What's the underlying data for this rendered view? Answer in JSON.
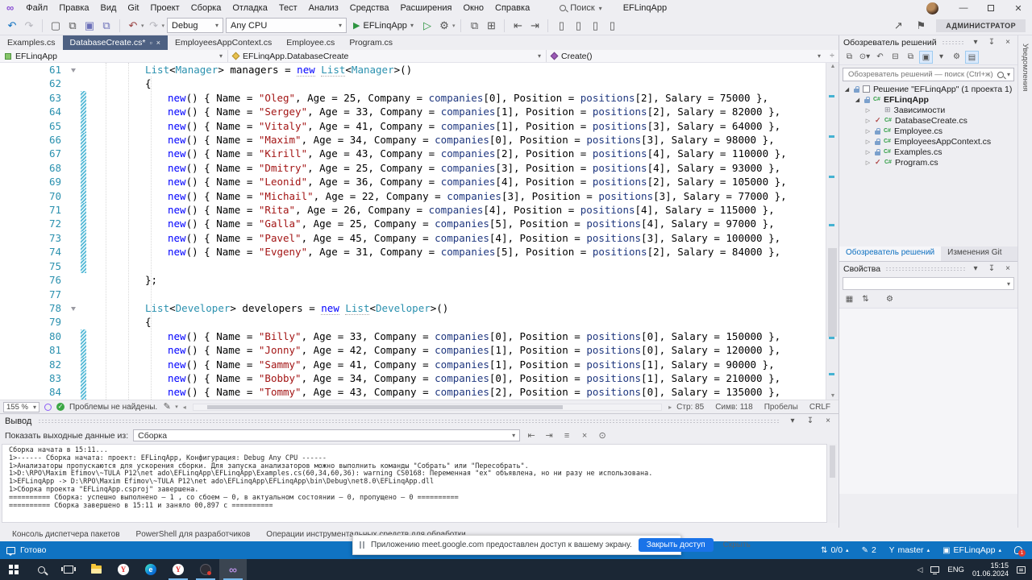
{
  "titlebar": {
    "menu": [
      "Файл",
      "Правка",
      "Вид",
      "Git",
      "Проект",
      "Сборка",
      "Отладка",
      "Тест",
      "Анализ",
      "Средства",
      "Расширения",
      "Окно",
      "Справка"
    ],
    "search_label": "Поиск",
    "window_title": "EFLinqApp"
  },
  "toolbar": {
    "config": "Debug",
    "platform": "Any CPU",
    "run_label": "EFLinqApp",
    "admin_badge": "АДМИНИСТРАТОР"
  },
  "tabs": [
    {
      "label": "Examples.cs",
      "active": false
    },
    {
      "label": "DatabaseCreate.cs*",
      "active": true
    },
    {
      "label": "EmployeesAppContext.cs",
      "active": false
    },
    {
      "label": "Employee.cs",
      "active": false
    },
    {
      "label": "Program.cs",
      "active": false
    }
  ],
  "breadcrumb": {
    "segments": [
      "EFLinqApp",
      "EFLinqApp.DatabaseCreate",
      "Create()"
    ]
  },
  "editor": {
    "zoom_level": "155 %",
    "problems_text": "Проблемы не найдены.",
    "caret": {
      "line": "Стр: 85",
      "column": "Симв: 118",
      "spaces": "Пробелы",
      "eol": "CRLF"
    },
    "lines": [
      {
        "n": 61,
        "kind": "decl",
        "type": "Manager",
        "varname": "managers",
        "ind": 2,
        "fold": true
      },
      {
        "n": 62,
        "kind": "brace",
        "text": "{",
        "ind": 2
      },
      {
        "n": 63,
        "kind": "item",
        "name": "Oleg",
        "age": 25,
        "comp": 0,
        "pos": 2,
        "salary": 75000,
        "ind": 3,
        "chg": true
      },
      {
        "n": 64,
        "kind": "item",
        "name": "Sergey",
        "age": 33,
        "comp": 1,
        "pos": 2,
        "salary": 82000,
        "ind": 3,
        "chg": true
      },
      {
        "n": 65,
        "kind": "item",
        "name": "Vitaly",
        "age": 41,
        "comp": 1,
        "pos": 3,
        "salary": 64000,
        "ind": 3,
        "chg": true
      },
      {
        "n": 66,
        "kind": "item",
        "name": "Maxim",
        "age": 34,
        "comp": 0,
        "pos": 3,
        "salary": 98000,
        "ind": 3,
        "chg": true
      },
      {
        "n": 67,
        "kind": "item",
        "name": "Kirill",
        "age": 43,
        "comp": 2,
        "pos": 4,
        "salary": 110000,
        "ind": 3,
        "chg": true
      },
      {
        "n": 68,
        "kind": "item",
        "name": "Dmitry",
        "age": 25,
        "comp": 3,
        "pos": 4,
        "salary": 93000,
        "ind": 3,
        "chg": true
      },
      {
        "n": 69,
        "kind": "item",
        "name": "Leonid",
        "age": 36,
        "comp": 4,
        "pos": 2,
        "salary": 105000,
        "ind": 3,
        "chg": true
      },
      {
        "n": 70,
        "kind": "item",
        "name": "Michail",
        "age": 22,
        "comp": 3,
        "pos": 3,
        "salary": 77000,
        "ind": 3,
        "chg": true
      },
      {
        "n": 71,
        "kind": "item",
        "name": "Rita",
        "age": 26,
        "comp": 4,
        "pos": 4,
        "salary": 115000,
        "ind": 3,
        "chg": true
      },
      {
        "n": 72,
        "kind": "item",
        "name": "Galla",
        "age": 25,
        "comp": 5,
        "pos": 4,
        "salary": 97000,
        "ind": 3,
        "chg": true
      },
      {
        "n": 73,
        "kind": "item",
        "name": "Pavel",
        "age": 45,
        "comp": 4,
        "pos": 3,
        "salary": 100000,
        "ind": 3,
        "chg": true
      },
      {
        "n": 74,
        "kind": "item",
        "name": "Evgeny",
        "age": 31,
        "comp": 5,
        "pos": 2,
        "salary": 84000,
        "ind": 3,
        "chg": true
      },
      {
        "n": 75,
        "kind": "empty",
        "chg": true
      },
      {
        "n": 76,
        "kind": "brace",
        "text": "};",
        "ind": 2
      },
      {
        "n": 77,
        "kind": "empty"
      },
      {
        "n": 78,
        "kind": "decl",
        "type": "Developer",
        "varname": "developers",
        "ind": 2,
        "fold": true
      },
      {
        "n": 79,
        "kind": "brace",
        "text": "{",
        "ind": 2
      },
      {
        "n": 80,
        "kind": "item",
        "name": "Billy",
        "age": 33,
        "comp": 0,
        "pos": 0,
        "salary": 150000,
        "ind": 3,
        "chg": true
      },
      {
        "n": 81,
        "kind": "item",
        "name": "Jonny",
        "age": 42,
        "comp": 1,
        "pos": 0,
        "salary": 120000,
        "ind": 3,
        "chg": true
      },
      {
        "n": 82,
        "kind": "item",
        "name": "Sammy",
        "age": 41,
        "comp": 1,
        "pos": 1,
        "salary": 90000,
        "ind": 3,
        "chg": true
      },
      {
        "n": 83,
        "kind": "item",
        "name": "Bobby",
        "age": 34,
        "comp": 0,
        "pos": 1,
        "salary": 210000,
        "ind": 3,
        "chg": true
      },
      {
        "n": 84,
        "kind": "item",
        "name": "Tommy",
        "age": 43,
        "comp": 2,
        "pos": 0,
        "salary": 135000,
        "ind": 3,
        "chg": true
      }
    ]
  },
  "solution_explorer": {
    "title": "Обозреватель решений",
    "search_placeholder": "Обозреватель решений — поиск (Ctrl+ж)",
    "tree": [
      {
        "label": "Решение \"EFLinqApp\" (1 проекта 1)",
        "level": 0,
        "arrow": "open",
        "icon": "solution",
        "status": "lock"
      },
      {
        "label": "EFLinqApp",
        "level": 1,
        "arrow": "open",
        "icon": "csproj",
        "status": "lock",
        "bold": true
      },
      {
        "label": "Зависимости",
        "level": 2,
        "arrow": "closed",
        "icon": "dep",
        "status": "none"
      },
      {
        "label": "DatabaseCreate.cs",
        "level": 2,
        "arrow": "closed",
        "icon": "cs",
        "status": "check"
      },
      {
        "label": "Employee.cs",
        "level": 2,
        "arrow": "closed",
        "icon": "cs",
        "status": "lock"
      },
      {
        "label": "EmployeesAppContext.cs",
        "level": 2,
        "arrow": "closed",
        "icon": "cs",
        "status": "lock"
      },
      {
        "label": "Examples.cs",
        "level": 2,
        "arrow": "closed",
        "icon": "cs",
        "status": "lock"
      },
      {
        "label": "Program.cs",
        "level": 2,
        "arrow": "closed",
        "icon": "cs",
        "status": "check"
      }
    ],
    "bottom_tabs": [
      {
        "label": "Обозреватель решений",
        "active": true
      },
      {
        "label": "Изменения Git",
        "active": false
      }
    ]
  },
  "properties_panel": {
    "title": "Свойства"
  },
  "right_strip": {
    "label": "Уведомления"
  },
  "output": {
    "title": "Вывод",
    "filter_label": "Показать выходные данные из:",
    "source_value": "Сборка",
    "lines": [
      "Сборка начата в 15:11...",
      "1>------ Сборка начата: проект: EFLinqApp, Конфигурация: Debug Any CPU ------",
      "1>Анализаторы пропускаются для ускорения сборки. Для запуска анализаторов можно выполнить команды \"Собрать\" или \"Пересобрать\".",
      "1>D:\\RPO\\Maxim Efimov\\~TULA P12\\net ado\\EFLinqApp\\EFLinqApp\\Examples.cs(60,34,60,36): warning CS0168: Переменная \"ex\" объявлена, но ни разу не использована.",
      "1>EFLinqApp -> D:\\RPO\\Maxim Efimov\\~TULA P12\\net ado\\EFLinqApp\\EFLinqApp\\bin\\Debug\\net8.0\\EFLinqApp.dll",
      "1>Сборка проекта \"EFLinqApp.csproj\" завершена.",
      "========== Сборка: успешно выполнено — 1 , со сбоем — 0, в актуальном состоянии — 0, пропущено — 0 ==========",
      "========== Сборка завершено в 15:11 и заняло 00,897 с =========="
    ]
  },
  "panel_tabs": [
    "Консоль диспетчера пакетов",
    "PowerShell для разработчиков",
    "Операции инструментальных средств для обработки..."
  ],
  "status_bar": {
    "ready": "Готово",
    "sync_count": "0/0",
    "pending_changes": "2",
    "branch": "master",
    "repo": "EFLinqApp",
    "bell_badge": "1"
  },
  "notification": {
    "message": "Приложению meet.google.com предоставлен доступ к вашему экрану.",
    "stop_button": "Закрыть доступ",
    "hide_button": "Скрыть"
  },
  "taskbar": {
    "buttons": [
      {
        "name": "start"
      },
      {
        "name": "search"
      },
      {
        "name": "task-view"
      },
      {
        "name": "file-explorer"
      },
      {
        "name": "yandex-browser"
      },
      {
        "name": "edge"
      },
      {
        "name": "yandex-browser-2",
        "active": true
      },
      {
        "name": "screen-share",
        "active": true
      },
      {
        "name": "visual-studio",
        "active": true,
        "highlight": true
      }
    ],
    "tray": {
      "lang": "ENG",
      "time": "15:15",
      "date": "01.06.2024"
    }
  },
  "colors": {
    "accent_blue": "#1073c2",
    "active_tab": "#4d6082",
    "keyword": "#0000ff",
    "type": "#2b91af",
    "string": "#a31515"
  }
}
